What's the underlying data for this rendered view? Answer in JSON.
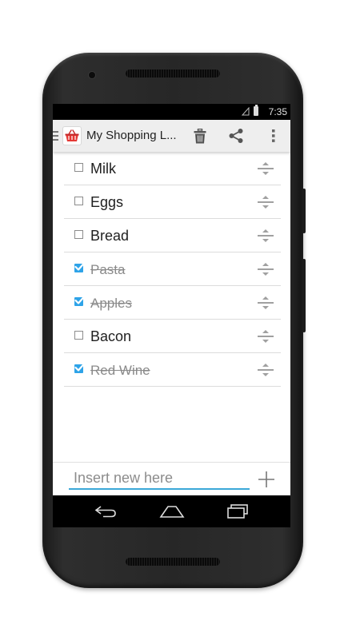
{
  "status_bar": {
    "time": "7:35"
  },
  "app_bar": {
    "title": "My Shopping L...",
    "app_icon": "shopping-basket-icon",
    "actions": [
      "trash-icon",
      "share-icon",
      "more-vert-icon"
    ]
  },
  "items": [
    {
      "label": "Milk",
      "checked": false
    },
    {
      "label": "Eggs",
      "checked": false
    },
    {
      "label": "Bread",
      "checked": false
    },
    {
      "label": "Pasta",
      "checked": true
    },
    {
      "label": "Apples",
      "checked": true
    },
    {
      "label": "Bacon",
      "checked": false
    },
    {
      "label": "Red Wine",
      "checked": true
    }
  ],
  "new_item": {
    "placeholder": "Insert new here",
    "value": ""
  },
  "nav": [
    "back-icon",
    "home-icon",
    "recents-icon"
  ],
  "colors": {
    "accent": "#2ea3e8",
    "input_underline": "#3aa8d8",
    "basket": "#e53935"
  }
}
